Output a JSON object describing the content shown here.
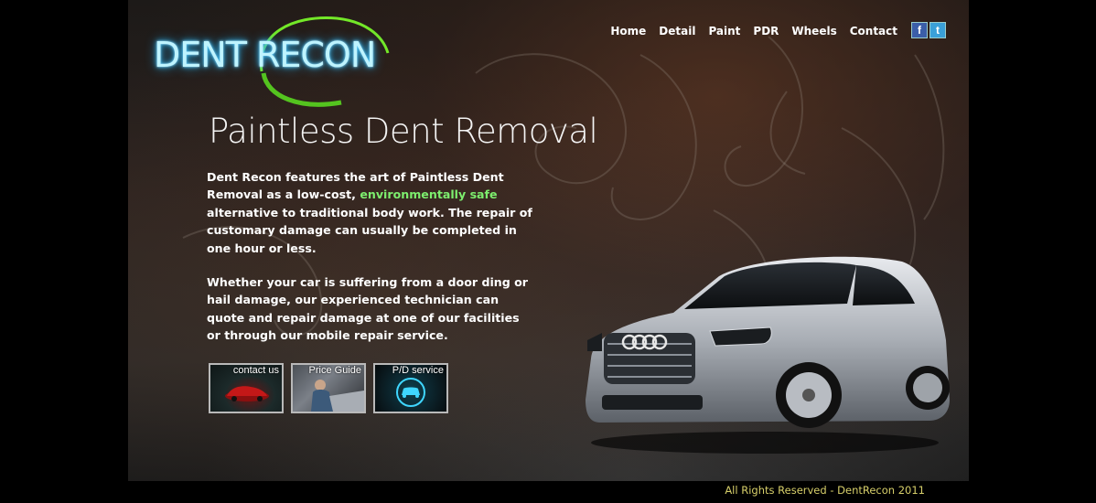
{
  "logo": {
    "text": "DENT RECON",
    "accent": "#7cff2a"
  },
  "nav": {
    "items": [
      "Home",
      "Detail",
      "Paint",
      "PDR",
      "Wheels",
      "Contact"
    ]
  },
  "social": {
    "facebook": "f",
    "twitter": "t"
  },
  "hero": {
    "headline": "Paintless Dent Removal",
    "p1_before": "Dent Recon features the art of Paintless Dent Removal as a low-cost, ",
    "p1_highlight": "environmentally safe",
    "p1_after": " alternative to traditional body work. The repair of customary damage can usually be completed in one hour or less.",
    "p2": "Whether your car is suffering from a door ding or hail damage, our experienced technician can quote and repair damage at one of our facilities or through our mobile repair service."
  },
  "thumbs": [
    "contact us",
    "Price Guide",
    "P/D service"
  ],
  "footer": {
    "text": "All Rights Reserved - DentRecon 2011"
  },
  "colors": {
    "highlight": "#7dee6e",
    "footer": "#d7cf6a",
    "logo_glow": "#37c4ff"
  }
}
